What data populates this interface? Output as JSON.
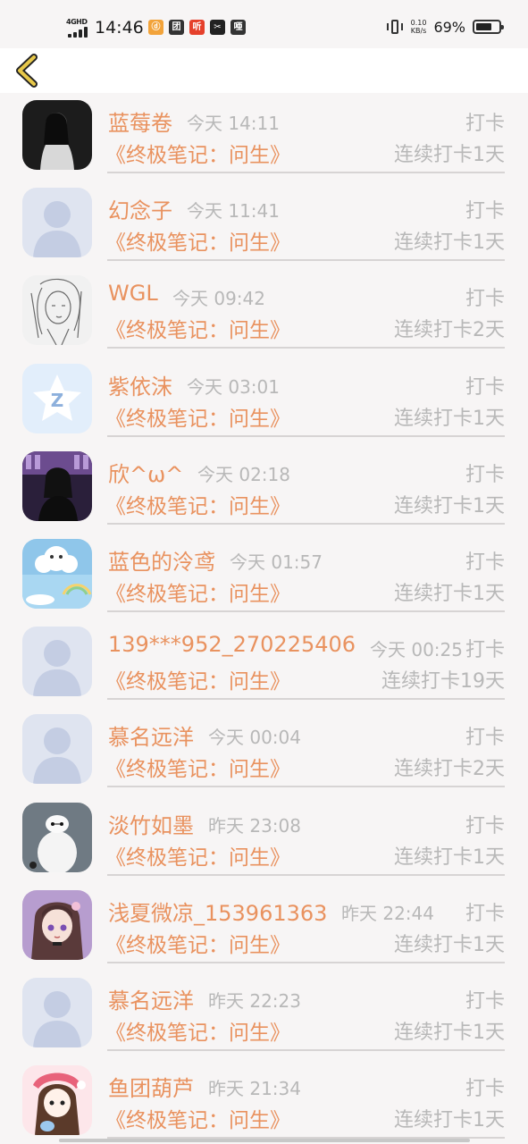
{
  "status_bar": {
    "network": "4GHD",
    "time": "14:46",
    "apps": [
      {
        "icon": "app-icon-1",
        "glyph": "ⓓ",
        "color": "#f2a33a"
      },
      {
        "icon": "app-icon-2",
        "glyph": "团",
        "color": "#333333"
      },
      {
        "icon": "app-icon-3",
        "glyph": "听",
        "color": "#e5402b"
      },
      {
        "icon": "app-icon-4",
        "glyph": "✂",
        "color": "#222222"
      },
      {
        "icon": "app-icon-5",
        "glyph": "唖",
        "color": "#333333"
      }
    ],
    "speed_value": "0.10",
    "speed_unit": "KB/s",
    "battery_pct": "69%",
    "battery_level": 0.69
  },
  "header": {
    "back_icon": "chevron-left-icon",
    "accent": "#e7c84a"
  },
  "colors": {
    "accent": "#e9925f",
    "muted": "#b8b8b8"
  },
  "entries": [
    {
      "name": "蓝莓卷",
      "time": "今天 14:11",
      "label": "打卡",
      "book": "《终极笔记：问生》",
      "streak": "连续打卡1天",
      "avatar": "photo-dark"
    },
    {
      "name": "幻念子",
      "time": "今天 11:41",
      "label": "打卡",
      "book": "《终极笔记：问生》",
      "streak": "连续打卡1天",
      "avatar": "default"
    },
    {
      "name": "WGL",
      "time": "今天 09:42",
      "label": "打卡",
      "book": "《终极笔记：问生》",
      "streak": "连续打卡2天",
      "avatar": "sketch"
    },
    {
      "name": "紫依沫",
      "time": "今天 03:01",
      "label": "打卡",
      "book": "《终极笔记：问生》",
      "streak": "连续打卡1天",
      "avatar": "qq"
    },
    {
      "name": "欣^ω^",
      "time": "今天 02:18",
      "label": "打卡",
      "book": "《终极笔记：问生》",
      "streak": "连续打卡1天",
      "avatar": "photo-purple"
    },
    {
      "name": "蓝色的泠鸢",
      "time": "今天 01:57",
      "label": "打卡",
      "book": "《终极笔记：问生》",
      "streak": "连续打卡1天",
      "avatar": "sky"
    },
    {
      "name": "139***952_270225406",
      "time": "今天 00:25",
      "label": "打卡",
      "book": "《终极笔记：问生》",
      "streak": "连续打卡19天",
      "avatar": "default"
    },
    {
      "name": "慕名远洋",
      "time": "今天 00:04",
      "label": "打卡",
      "book": "《终极笔记：问生》",
      "streak": "连续打卡2天",
      "avatar": "default"
    },
    {
      "name": "淡竹如墨",
      "time": "昨天 23:08",
      "label": "打卡",
      "book": "《终极笔记：问生》",
      "streak": "连续打卡1天",
      "avatar": "baymax"
    },
    {
      "name": "浅夏微凉_153961363",
      "time": "昨天 22:44",
      "label": "打卡",
      "book": "《终极笔记：问生》",
      "streak": "连续打卡1天",
      "avatar": "anime"
    },
    {
      "name": "慕名远洋",
      "time": "昨天 22:23",
      "label": "打卡",
      "book": "《终极笔记：问生》",
      "streak": "连续打卡1天",
      "avatar": "default"
    },
    {
      "name": "鱼团葫芦",
      "time": "昨天 21:34",
      "label": "打卡",
      "book": "《终极笔记：问生》",
      "streak": "连续打卡1天",
      "avatar": "cartoon"
    }
  ]
}
